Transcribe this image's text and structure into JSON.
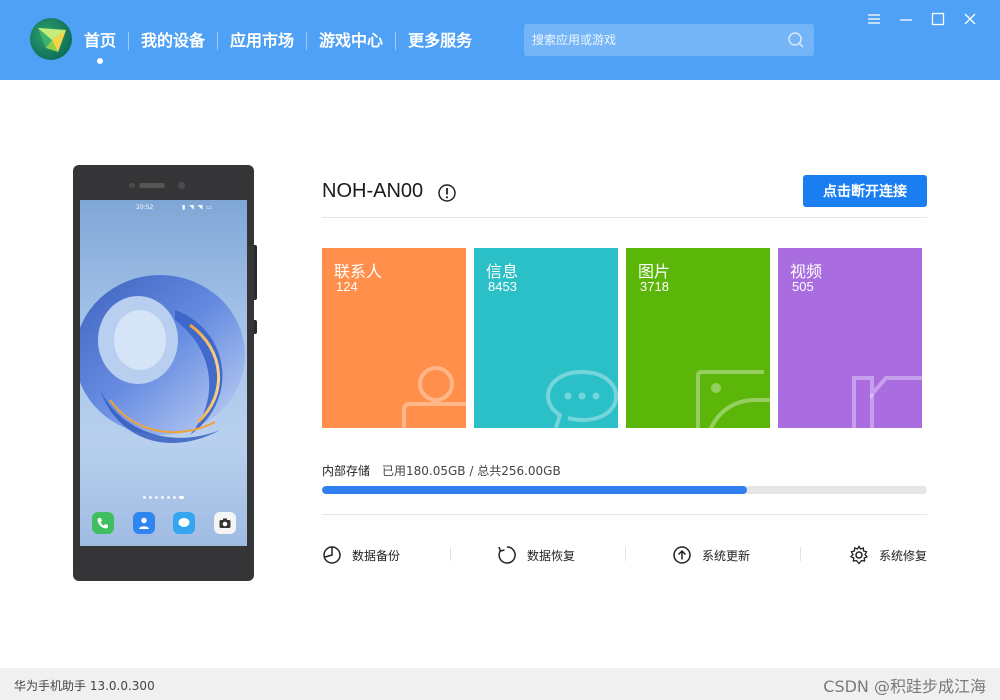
{
  "header": {
    "nav": [
      {
        "label": "首页",
        "active": true
      },
      {
        "label": "我的设备",
        "active": false
      },
      {
        "label": "应用市场",
        "active": false
      },
      {
        "label": "游戏中心",
        "active": false
      },
      {
        "label": "更多服务",
        "active": false
      }
    ],
    "search": {
      "placeholder": "搜索应用或游戏"
    },
    "accent_color": "#4ea1f5"
  },
  "phone": {
    "status_time": "20:52"
  },
  "device": {
    "name": "NOH-AN00",
    "disconnect_label": "点击断开连接"
  },
  "tiles": [
    {
      "label": "联系人",
      "count": "124",
      "color": "#ff8f4a",
      "icon": "person-icon"
    },
    {
      "label": "信息",
      "count": "8453",
      "color": "#2bbfc8",
      "icon": "message-icon"
    },
    {
      "label": "图片",
      "count": "3718",
      "color": "#5cb60a",
      "icon": "image-icon"
    },
    {
      "label": "视频",
      "count": "505",
      "color": "#a96de0",
      "icon": "video-icon"
    }
  ],
  "storage": {
    "label": "内部存储",
    "usage_text": "已用180.05GB / 总共256.00GB",
    "used_fraction": 0.7033
  },
  "actions": [
    {
      "label": "数据备份",
      "icon": "backup-icon"
    },
    {
      "label": "数据恢复",
      "icon": "restore-icon"
    },
    {
      "label": "系统更新",
      "icon": "update-icon"
    },
    {
      "label": "系统修复",
      "icon": "repair-icon"
    }
  ],
  "footer": {
    "version": "华为手机助手 13.0.0.300",
    "watermark": "CSDN @积跬步成江海"
  }
}
